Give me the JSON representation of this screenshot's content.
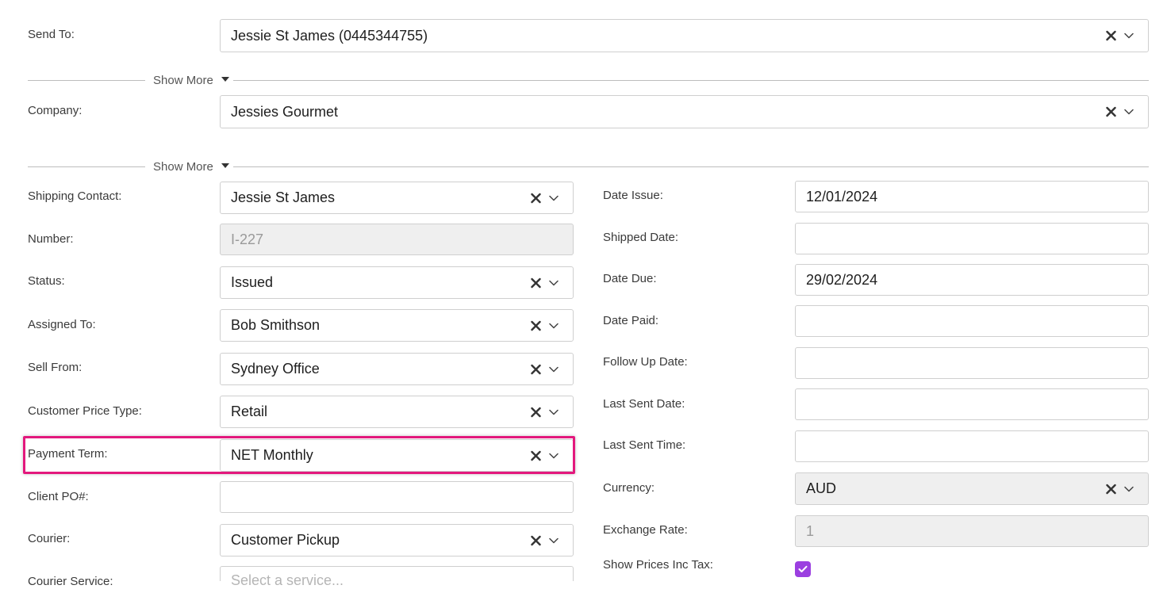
{
  "send_to": {
    "label": "Send To:",
    "value": "Jessie St James (0445344755)"
  },
  "show_more_1": "Show More",
  "company": {
    "label": "Company:",
    "value": "Jessies Gourmet"
  },
  "show_more_2": "Show More",
  "left": {
    "shipping_contact": {
      "label": "Shipping Contact:",
      "value": "Jessie St James"
    },
    "number": {
      "label": "Number:",
      "value": "I-227"
    },
    "status": {
      "label": "Status:",
      "value": "Issued"
    },
    "assigned_to": {
      "label": "Assigned To:",
      "value": "Bob Smithson"
    },
    "sell_from": {
      "label": "Sell From:",
      "value": "Sydney Office"
    },
    "customer_price_type": {
      "label": "Customer Price Type:",
      "value": "Retail"
    },
    "payment_term": {
      "label": "Payment Term:",
      "value": "NET Monthly"
    },
    "client_po": {
      "label": "Client PO#:",
      "value": ""
    },
    "courier": {
      "label": "Courier:",
      "value": "Customer Pickup"
    },
    "courier_service": {
      "label": "Courier Service:",
      "placeholder": "Select a service..."
    }
  },
  "right": {
    "date_issue": {
      "label": "Date Issue:",
      "value": "12/01/2024"
    },
    "shipped_date": {
      "label": "Shipped Date:",
      "value": ""
    },
    "date_due": {
      "label": "Date Due:",
      "value": "29/02/2024"
    },
    "date_paid": {
      "label": "Date Paid:",
      "value": ""
    },
    "follow_up_date": {
      "label": "Follow Up Date:",
      "value": ""
    },
    "last_sent_date": {
      "label": "Last Sent Date:",
      "value": ""
    },
    "last_sent_time": {
      "label": "Last Sent Time:",
      "value": ""
    },
    "currency": {
      "label": "Currency:",
      "value": "AUD"
    },
    "exchange_rate": {
      "label": "Exchange Rate:",
      "value": "1"
    },
    "show_prices_inc_tax": {
      "label": "Show Prices Inc Tax:",
      "checked": true
    }
  },
  "colors": {
    "highlight": "#e3187d",
    "checkbox": "#9b3fe0"
  }
}
